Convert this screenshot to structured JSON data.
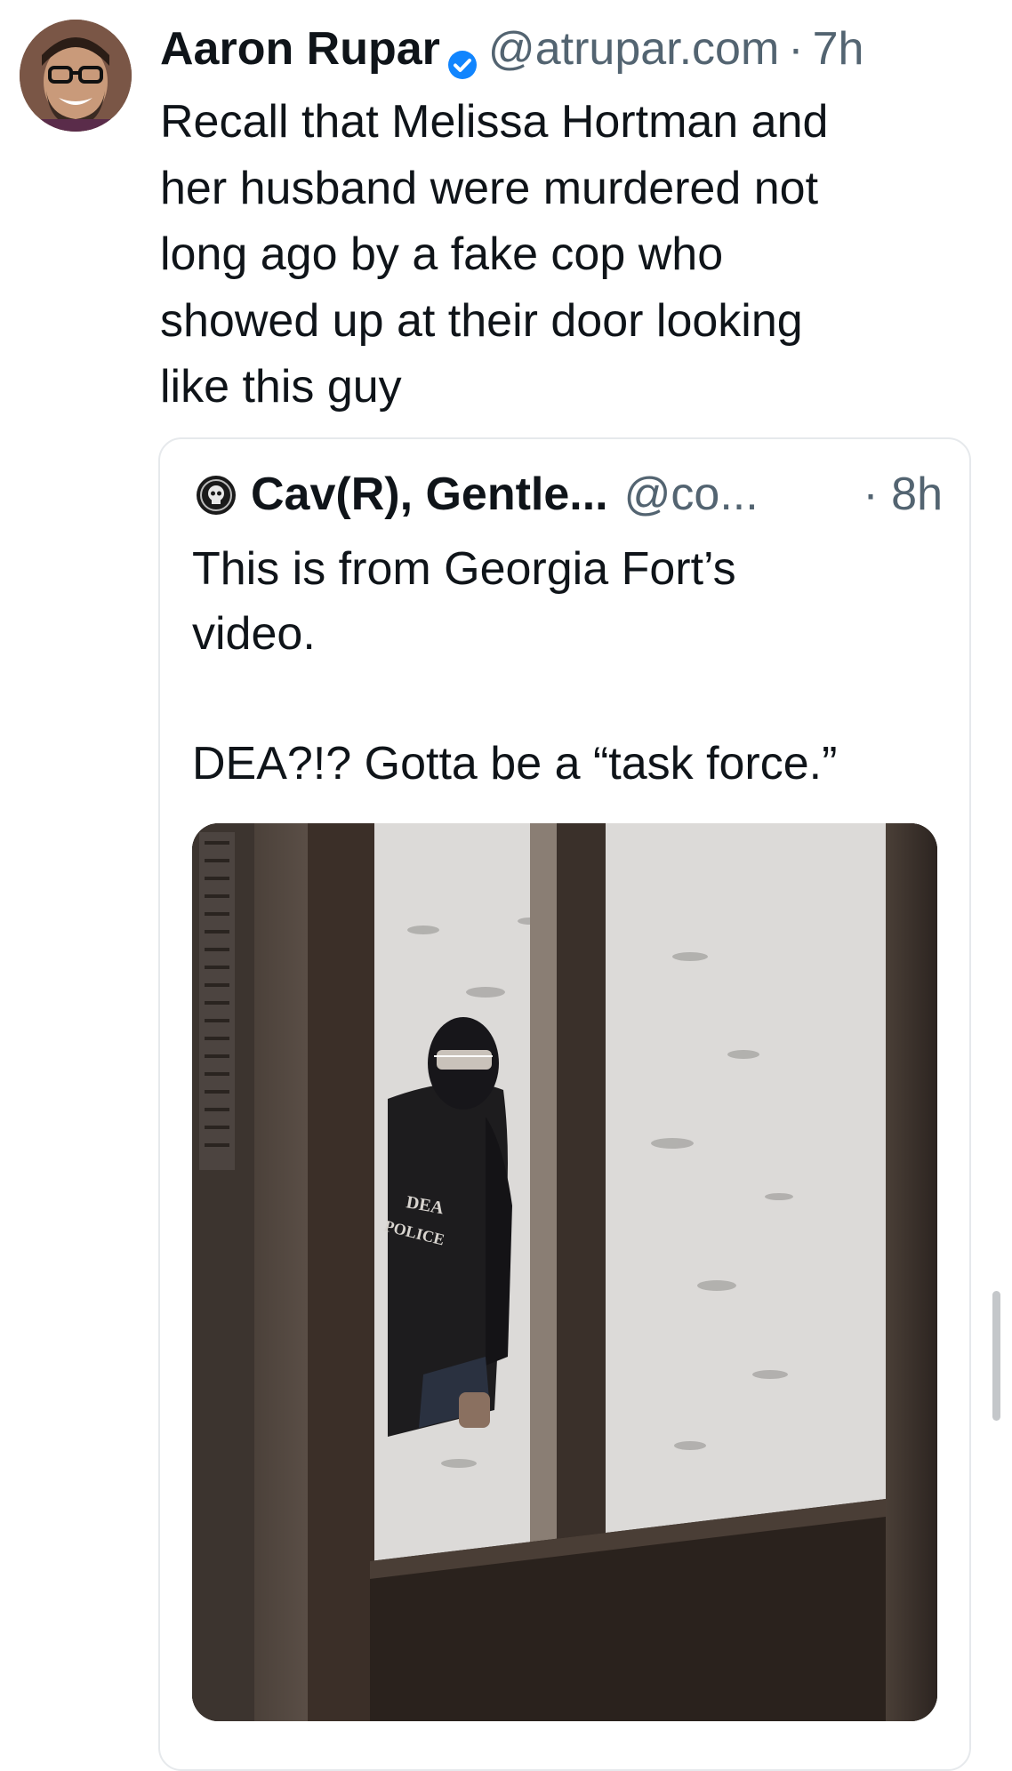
{
  "post": {
    "author_name": "Aaron Rupar",
    "handle": "@atrupar.com",
    "separator": "·",
    "time": "7h",
    "text": "Recall that Melissa Hortman and\nher husband were murdered not\nlong ago by a fake cop who\nshowed up at their door looking\nlike this guy"
  },
  "quoted_post": {
    "author_name": "Cav(R), Gentle...",
    "handle": "@co...",
    "time": "· 8h",
    "text": "This is from Georgia Fort’s\nvideo.\n\nDEA?!? Gotta be a “task force.”",
    "media_labels": {
      "line1": "DEA",
      "line2": "POLICE"
    }
  },
  "icons": {
    "avatar": "avatar-photo",
    "verified": "verified-badge-icon",
    "quoted_avatar": "skull-emblem-icon"
  },
  "colors": {
    "text_primary": "#0f1419",
    "text_secondary": "#536471",
    "verified_blue": "#1185fe",
    "card_border": "#e6e9ec"
  }
}
